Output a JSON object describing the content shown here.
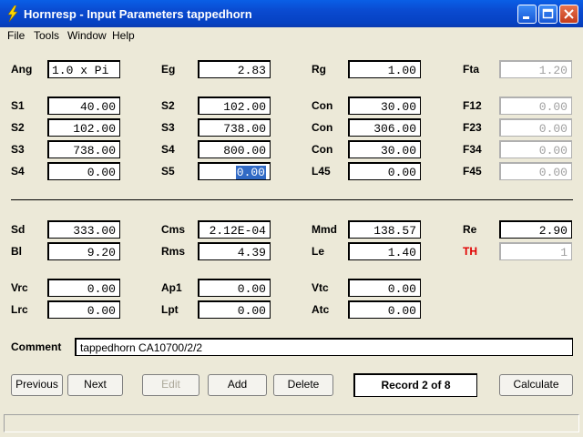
{
  "window": {
    "title": "Hornresp - Input Parameters   tappedhorn"
  },
  "menu": [
    "File",
    "Tools",
    "Window",
    "Help"
  ],
  "labels": {
    "ang": "Ang",
    "eg": "Eg",
    "rg": "Rg",
    "fta": "Fta",
    "s1a": "S1",
    "s2a": "S2",
    "con1": "Con",
    "f12": "F12",
    "s2b": "S2",
    "s3a": "S3",
    "con2": "Con",
    "f23": "F23",
    "s3b": "S3",
    "s4a": "S4",
    "con3": "Con",
    "f34": "F34",
    "s4b": "S4",
    "s5": "S5",
    "l45": "L45",
    "f45": "F45",
    "sd": "Sd",
    "cms": "Cms",
    "mmd": "Mmd",
    "re": "Re",
    "bl": "Bl",
    "rms": "Rms",
    "le": "Le",
    "th": "TH",
    "vrc": "Vrc",
    "ap1": "Ap1",
    "vtc": "Vtc",
    "lrc": "Lrc",
    "lpt": "Lpt",
    "atc": "Atc",
    "comment": "Comment"
  },
  "values": {
    "ang": "1.0 x Pi",
    "eg": "2.83",
    "rg": "1.00",
    "fta": "1.20",
    "s1a": "40.00",
    "s2a": "102.00",
    "con1": "30.00",
    "f12": "0.00",
    "s2b": "102.00",
    "s3a": "738.00",
    "con2": "306.00",
    "f23": "0.00",
    "s3b": "738.00",
    "s4a": "800.00",
    "con3": "30.00",
    "f34": "0.00",
    "s4b": "0.00",
    "s5": "0.00",
    "l45": "0.00",
    "f45": "0.00",
    "sd": "333.00",
    "cms": "2.12E-04",
    "mmd": "138.57",
    "re": "2.90",
    "bl": "9.20",
    "rms": "4.39",
    "le": "1.40",
    "th": "1",
    "vrc": "0.00",
    "ap1": "0.00",
    "vtc": "0.00",
    "lrc": "0.00",
    "lpt": "0.00",
    "atc": "0.00",
    "comment": "tappedhorn CA10700/2/2"
  },
  "buttons": {
    "previous": "Previous",
    "next": "Next",
    "edit": "Edit",
    "add": "Add",
    "delete": "Delete",
    "calculate": "Calculate"
  },
  "record": "Record 2 of 8",
  "colors": {
    "titlebar": "#0a4ad0",
    "selection": "#316ac5",
    "th_label": "#e00000"
  }
}
